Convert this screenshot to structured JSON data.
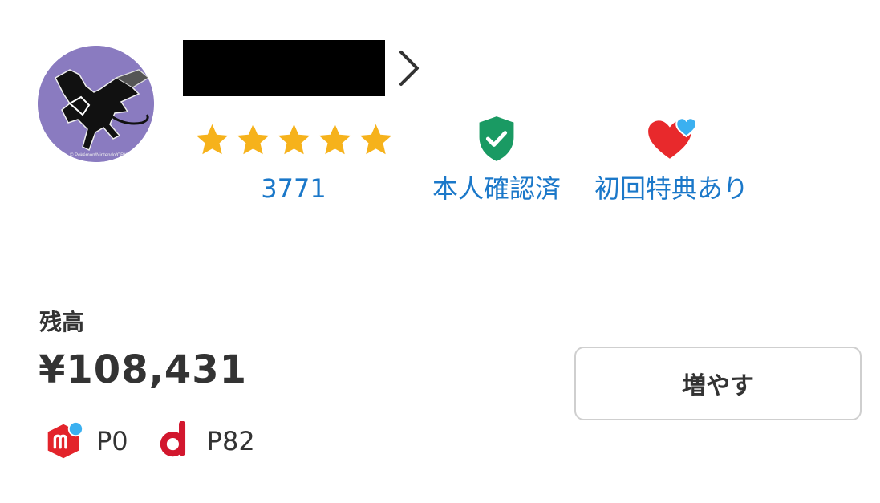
{
  "profile": {
    "avatar_caption": "© Pokémon/Nintendo/CR/GF",
    "rating_count": "3771",
    "verified_label": "本人確認済",
    "first_benefit_label": "初回特典あり",
    "stars": 5
  },
  "balance": {
    "title": "残高",
    "amount": "¥108,431",
    "increase_label": "増やす"
  },
  "points": [
    {
      "name": "merpay-point",
      "value": "P0"
    },
    {
      "name": "d-point",
      "value": "P82"
    }
  ],
  "colors": {
    "link_blue": "#1b78c9",
    "star": "#f6b21b",
    "shield": "#1a9a63",
    "heart_red": "#e8292c",
    "heart_blue": "#3bb0f0",
    "mercari_red": "#e3242b",
    "d_red": "#d2172e"
  }
}
